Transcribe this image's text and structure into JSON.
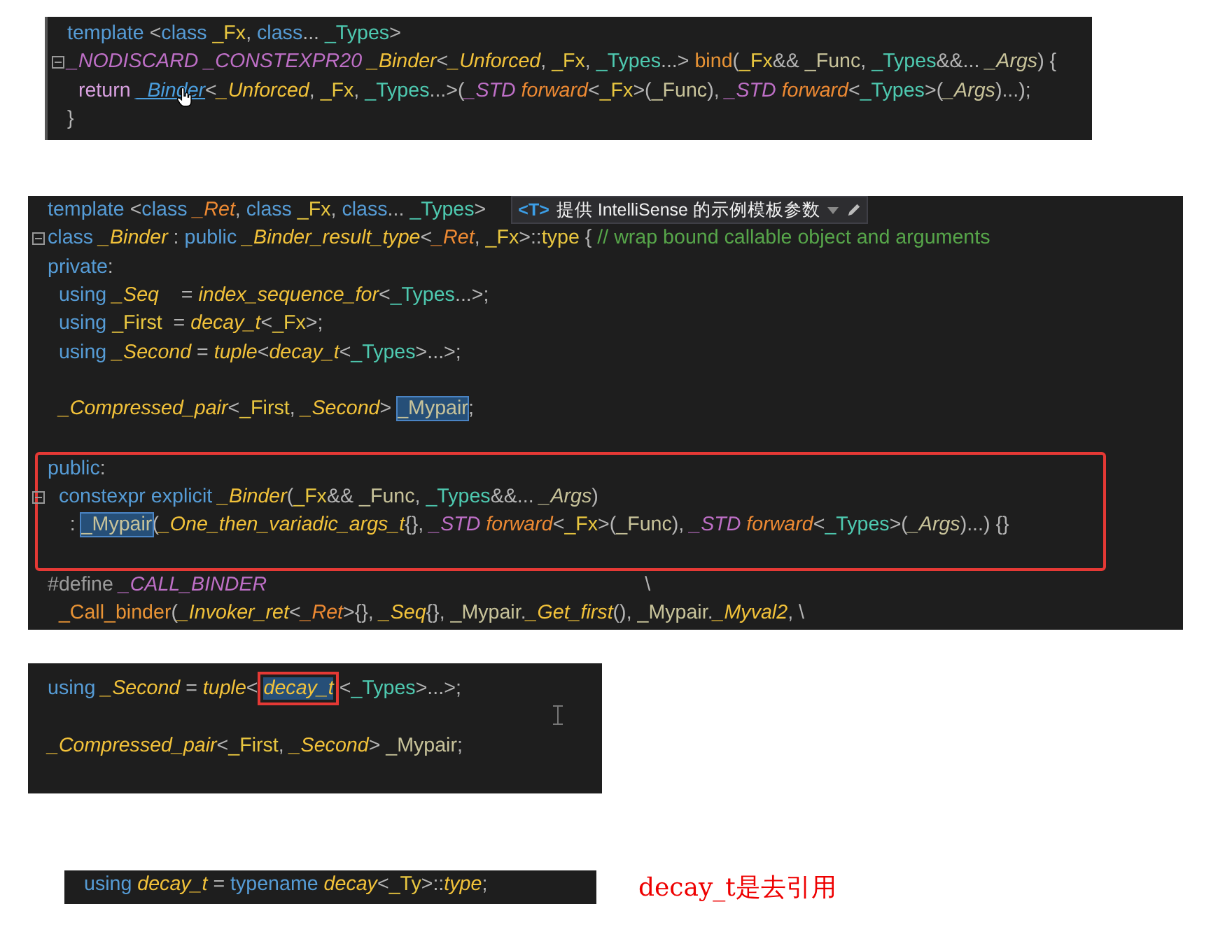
{
  "panels": [
    {
      "pointer": {
        "kind": "hand"
      },
      "sections": [
        {
          "boxed": false,
          "lines": [
            {
              "kind": "code",
              "fold": false,
              "tokens": [
                {
                  "kind": "kw",
                  "text": "template"
                },
                {
                  "kind": "p",
                  "text": " <"
                },
                {
                  "kind": "kw",
                  "text": "class "
                },
                {
                  "kind": "tpar",
                  "text": "_Fx"
                },
                {
                  "kind": "p",
                  "text": ", "
                },
                {
                  "kind": "kw",
                  "text": "class"
                },
                {
                  "kind": "p",
                  "text": "... "
                },
                {
                  "kind": "tp",
                  "text": "_Types"
                },
                {
                  "kind": "p",
                  "text": ">"
                }
              ]
            },
            {
              "kind": "code",
              "fold": true,
              "tokens": [
                {
                  "kind": "macro",
                  "text": "_NODISCARD _CONSTEXPR20 "
                },
                {
                  "kind": "type",
                  "text": "_Binder"
                },
                {
                  "kind": "p",
                  "text": "<"
                },
                {
                  "kind": "type",
                  "text": "_Unforced"
                },
                {
                  "kind": "p",
                  "text": ", "
                },
                {
                  "kind": "tpar",
                  "text": "_Fx"
                },
                {
                  "kind": "p",
                  "text": ", "
                },
                {
                  "kind": "tp",
                  "text": "_Types"
                },
                {
                  "kind": "p",
                  "text": "...> "
                },
                {
                  "kind": "fn",
                  "text": "bind"
                },
                {
                  "kind": "p",
                  "text": "("
                },
                {
                  "kind": "tpar",
                  "text": "_Fx"
                },
                {
                  "kind": "p",
                  "text": "&& "
                },
                {
                  "kind": "argn",
                  "text": "_Func"
                },
                {
                  "kind": "p",
                  "text": ", "
                },
                {
                  "kind": "tp",
                  "text": "_Types"
                },
                {
                  "kind": "p",
                  "text": "&&... "
                },
                {
                  "kind": "arg",
                  "text": "_Args"
                },
                {
                  "kind": "p",
                  "text": ") {"
                }
              ]
            },
            {
              "kind": "code",
              "fold": false,
              "tokens": [
                {
                  "kind": "ctl",
                  "text": "  return "
                },
                {
                  "kind": "link",
                  "text": "_Binder"
                },
                {
                  "kind": "p",
                  "text": "<"
                },
                {
                  "kind": "type",
                  "text": "_Unforced"
                },
                {
                  "kind": "p",
                  "text": ", "
                },
                {
                  "kind": "tpar",
                  "text": "_Fx"
                },
                {
                  "kind": "p",
                  "text": ", "
                },
                {
                  "kind": "tp",
                  "text": "_Types"
                },
                {
                  "kind": "p",
                  "text": "...>("
                },
                {
                  "kind": "macro",
                  "text": "_STD "
                },
                {
                  "kind": "fni",
                  "text": "forward"
                },
                {
                  "kind": "p",
                  "text": "<"
                },
                {
                  "kind": "tpar",
                  "text": "_Fx"
                },
                {
                  "kind": "p",
                  "text": ">("
                },
                {
                  "kind": "argn",
                  "text": "_Func"
                },
                {
                  "kind": "p",
                  "text": "), "
                },
                {
                  "kind": "macro",
                  "text": "_STD "
                },
                {
                  "kind": "fni",
                  "text": "forward"
                },
                {
                  "kind": "p",
                  "text": "<"
                },
                {
                  "kind": "tp",
                  "text": "_Types"
                },
                {
                  "kind": "p",
                  "text": ">("
                },
                {
                  "kind": "arg",
                  "text": "_Args"
                },
                {
                  "kind": "p",
                  "text": ")...);"
                }
              ]
            },
            {
              "kind": "code",
              "fold": false,
              "tokens": [
                {
                  "kind": "p",
                  "text": "}"
                }
              ]
            }
          ]
        }
      ]
    },
    {
      "sections": [
        {
          "boxed": false,
          "lines": [
            {
              "kind": "code",
              "fold": false,
              "hint": {
                "badge": "<T>",
                "text": "提供 IntelliSense 的示例模板参数"
              },
              "tokens": [
                {
                  "kind": "kw",
                  "text": "template"
                },
                {
                  "kind": "p",
                  "text": " <"
                },
                {
                  "kind": "kw",
                  "text": "class "
                },
                {
                  "kind": "fni",
                  "text": "_Ret"
                },
                {
                  "kind": "p",
                  "text": ", "
                },
                {
                  "kind": "kw",
                  "text": "class "
                },
                {
                  "kind": "tpar",
                  "text": "_Fx"
                },
                {
                  "kind": "p",
                  "text": ", "
                },
                {
                  "kind": "kw",
                  "text": "class"
                },
                {
                  "kind": "p",
                  "text": "... "
                },
                {
                  "kind": "tp",
                  "text": "_Types"
                },
                {
                  "kind": "p",
                  "text": ">"
                }
              ]
            },
            {
              "kind": "code",
              "fold": true,
              "tokens": [
                {
                  "kind": "kw",
                  "text": "class "
                },
                {
                  "kind": "type",
                  "text": "_Binder"
                },
                {
                  "kind": "p",
                  "text": " : "
                },
                {
                  "kind": "kw",
                  "text": "public "
                },
                {
                  "kind": "type",
                  "text": "_Binder_result_type"
                },
                {
                  "kind": "p",
                  "text": "<"
                },
                {
                  "kind": "fni",
                  "text": "_Ret"
                },
                {
                  "kind": "p",
                  "text": ", "
                },
                {
                  "kind": "tpar",
                  "text": "_Fx"
                },
                {
                  "kind": "p",
                  "text": ">::"
                },
                {
                  "kind": "tpar",
                  "text": "type"
                },
                {
                  "kind": "p",
                  "text": " { "
                },
                {
                  "kind": "cmt",
                  "text": "// wrap bound callable object and arguments"
                }
              ]
            },
            {
              "kind": "code",
              "fold": false,
              "tokens": [
                {
                  "kind": "kw",
                  "text": "private"
                },
                {
                  "kind": "p",
                  "text": ":"
                }
              ]
            },
            {
              "kind": "code",
              "fold": false,
              "tokens": [
                {
                  "kind": "kw",
                  "text": "  using "
                },
                {
                  "kind": "type",
                  "text": "_Seq"
                },
                {
                  "kind": "p",
                  "text": "    = "
                },
                {
                  "kind": "type",
                  "text": "index_sequence_for"
                },
                {
                  "kind": "p",
                  "text": "<"
                },
                {
                  "kind": "tp",
                  "text": "_Types"
                },
                {
                  "kind": "p",
                  "text": "...>;"
                }
              ]
            },
            {
              "kind": "code",
              "fold": false,
              "tokens": [
                {
                  "kind": "kw",
                  "text": "  using "
                },
                {
                  "kind": "tpar",
                  "text": "_First"
                },
                {
                  "kind": "p",
                  "text": "  = "
                },
                {
                  "kind": "type",
                  "text": "decay_t"
                },
                {
                  "kind": "p",
                  "text": "<"
                },
                {
                  "kind": "tpar",
                  "text": "_Fx"
                },
                {
                  "kind": "p",
                  "text": ">;"
                }
              ]
            },
            {
              "kind": "code",
              "fold": false,
              "tokens": [
                {
                  "kind": "kw",
                  "text": "  using "
                },
                {
                  "kind": "type",
                  "text": "_Second"
                },
                {
                  "kind": "p",
                  "text": " = "
                },
                {
                  "kind": "type",
                  "text": "tuple"
                },
                {
                  "kind": "p",
                  "text": "<"
                },
                {
                  "kind": "type",
                  "text": "decay_t"
                },
                {
                  "kind": "p",
                  "text": "<"
                },
                {
                  "kind": "tp",
                  "text": "_Types"
                },
                {
                  "kind": "p",
                  "text": ">...>;"
                }
              ]
            },
            {
              "kind": "blank",
              "fold": false
            },
            {
              "kind": "code",
              "fold": false,
              "tokens": [
                {
                  "kind": "type",
                  "text": "  _Compressed_pair"
                },
                {
                  "kind": "p",
                  "text": "<"
                },
                {
                  "kind": "tpar",
                  "text": "_First"
                },
                {
                  "kind": "p",
                  "text": ", "
                },
                {
                  "kind": "type",
                  "text": "_Second"
                },
                {
                  "kind": "p",
                  "text": "> "
                },
                {
                  "kind": "sel",
                  "text": "_Mypair"
                },
                {
                  "kind": "p",
                  "text": ";"
                }
              ]
            },
            {
              "kind": "blank",
              "fold": false
            }
          ]
        },
        {
          "boxed": true,
          "lines": [
            {
              "kind": "code",
              "fold": false,
              "tokens": [
                {
                  "kind": "kw",
                  "text": "public"
                },
                {
                  "kind": "p",
                  "text": ":"
                }
              ]
            },
            {
              "kind": "code",
              "fold": true,
              "tokens": [
                {
                  "kind": "kw",
                  "text": "  constexpr explicit "
                },
                {
                  "kind": "type",
                  "text": "_Binder"
                },
                {
                  "kind": "p",
                  "text": "("
                },
                {
                  "kind": "tpar",
                  "text": "_Fx"
                },
                {
                  "kind": "p",
                  "text": "&& "
                },
                {
                  "kind": "argn",
                  "text": "_Func"
                },
                {
                  "kind": "p",
                  "text": ", "
                },
                {
                  "kind": "tp",
                  "text": "_Types"
                },
                {
                  "kind": "p",
                  "text": "&&... "
                },
                {
                  "kind": "arg",
                  "text": "_Args"
                },
                {
                  "kind": "p",
                  "text": ")"
                }
              ]
            },
            {
              "kind": "code",
              "fold": false,
              "tokens": [
                {
                  "kind": "p",
                  "text": "    : "
                },
                {
                  "kind": "sel",
                  "text": "_Mypair"
                },
                {
                  "kind": "p",
                  "text": "("
                },
                {
                  "kind": "type",
                  "text": "_One_then_variadic_args_t"
                },
                {
                  "kind": "p",
                  "text": "{}, "
                },
                {
                  "kind": "macro",
                  "text": "_STD "
                },
                {
                  "kind": "fni",
                  "text": "forward"
                },
                {
                  "kind": "p",
                  "text": "<"
                },
                {
                  "kind": "tpar",
                  "text": "_Fx"
                },
                {
                  "kind": "p",
                  "text": ">("
                },
                {
                  "kind": "argn",
                  "text": "_Func"
                },
                {
                  "kind": "p",
                  "text": "), "
                },
                {
                  "kind": "macro",
                  "text": "_STD "
                },
                {
                  "kind": "fni",
                  "text": "forward"
                },
                {
                  "kind": "p",
                  "text": "<"
                },
                {
                  "kind": "tp",
                  "text": "_Types"
                },
                {
                  "kind": "p",
                  "text": ">("
                },
                {
                  "kind": "arg",
                  "text": "_Args"
                },
                {
                  "kind": "p",
                  "text": ")...) {}"
                }
              ]
            },
            {
              "kind": "blank",
              "fold": false
            }
          ]
        },
        {
          "boxed": false,
          "lines": [
            {
              "kind": "code",
              "fold": false,
              "tokens": [
                {
                  "kind": "pp",
                  "text": "#define "
                },
                {
                  "kind": "macro",
                  "text": "_CALL_BINDER"
                },
                {
                  "kind": "p",
                  "text": "                                                                    \\"
                }
              ]
            },
            {
              "kind": "code",
              "fold": false,
              "tokens": [
                {
                  "kind": "fn",
                  "text": "  _Call_binder"
                },
                {
                  "kind": "p",
                  "text": "("
                },
                {
                  "kind": "type",
                  "text": "_Invoker_ret"
                },
                {
                  "kind": "p",
                  "text": "<"
                },
                {
                  "kind": "fni",
                  "text": "_Ret"
                },
                {
                  "kind": "p",
                  "text": ">{}, "
                },
                {
                  "kind": "type",
                  "text": "_Seq"
                },
                {
                  "kind": "p",
                  "text": "{}, "
                },
                {
                  "kind": "argn",
                  "text": "_Mypair"
                },
                {
                  "kind": "p",
                  "text": "."
                },
                {
                  "kind": "type",
                  "text": "_Get_first"
                },
                {
                  "kind": "p",
                  "text": "(), "
                },
                {
                  "kind": "argn",
                  "text": "_Mypair"
                },
                {
                  "kind": "p",
                  "text": "."
                },
                {
                  "kind": "type",
                  "text": "_Myval2"
                },
                {
                  "kind": "p",
                  "text": ", \\"
                }
              ]
            }
          ]
        }
      ]
    },
    {
      "pointer": {
        "kind": "ibeam"
      },
      "sections": [
        {
          "boxed": false,
          "lines": [
            {
              "kind": "code",
              "fold": false,
              "tokens": [
                {
                  "kind": "kw",
                  "text": "using "
                },
                {
                  "kind": "type",
                  "text": "_Second"
                },
                {
                  "kind": "p",
                  "text": " = "
                },
                {
                  "kind": "type",
                  "text": "tuple"
                },
                {
                  "kind": "p",
                  "text": "<"
                },
                {
                  "kind": "boxsel",
                  "text": "decay_t"
                },
                {
                  "kind": "p",
                  "text": "<"
                },
                {
                  "kind": "tp",
                  "text": "_Types"
                },
                {
                  "kind": "p",
                  "text": ">...>;"
                }
              ]
            },
            {
              "kind": "blank",
              "fold": false
            },
            {
              "kind": "code",
              "fold": false,
              "tokens": [
                {
                  "kind": "type",
                  "text": "_Compressed_pair"
                },
                {
                  "kind": "p",
                  "text": "<"
                },
                {
                  "kind": "tpar",
                  "text": "_First"
                },
                {
                  "kind": "p",
                  "text": ", "
                },
                {
                  "kind": "type",
                  "text": "_Second"
                },
                {
                  "kind": "p",
                  "text": "> "
                },
                {
                  "kind": "argn",
                  "text": "_Mypair"
                },
                {
                  "kind": "p",
                  "text": ";"
                }
              ]
            },
            {
              "kind": "blank",
              "fold": false
            }
          ]
        }
      ]
    },
    {
      "caption": "decay_t是去引用",
      "sections": [
        {
          "boxed": false,
          "lines": [
            {
              "kind": "code",
              "fold": false,
              "tokens": [
                {
                  "kind": "kw",
                  "text": "using "
                },
                {
                  "kind": "type",
                  "text": "decay_t"
                },
                {
                  "kind": "p",
                  "text": " = "
                },
                {
                  "kind": "kw",
                  "text": "typename "
                },
                {
                  "kind": "type",
                  "text": "decay"
                },
                {
                  "kind": "p",
                  "text": "<"
                },
                {
                  "kind": "tpar",
                  "text": "_Ty"
                },
                {
                  "kind": "p",
                  "text": ">::"
                },
                {
                  "kind": "type",
                  "text": "type"
                },
                {
                  "kind": "p",
                  "text": ";"
                }
              ]
            }
          ]
        }
      ]
    }
  ]
}
